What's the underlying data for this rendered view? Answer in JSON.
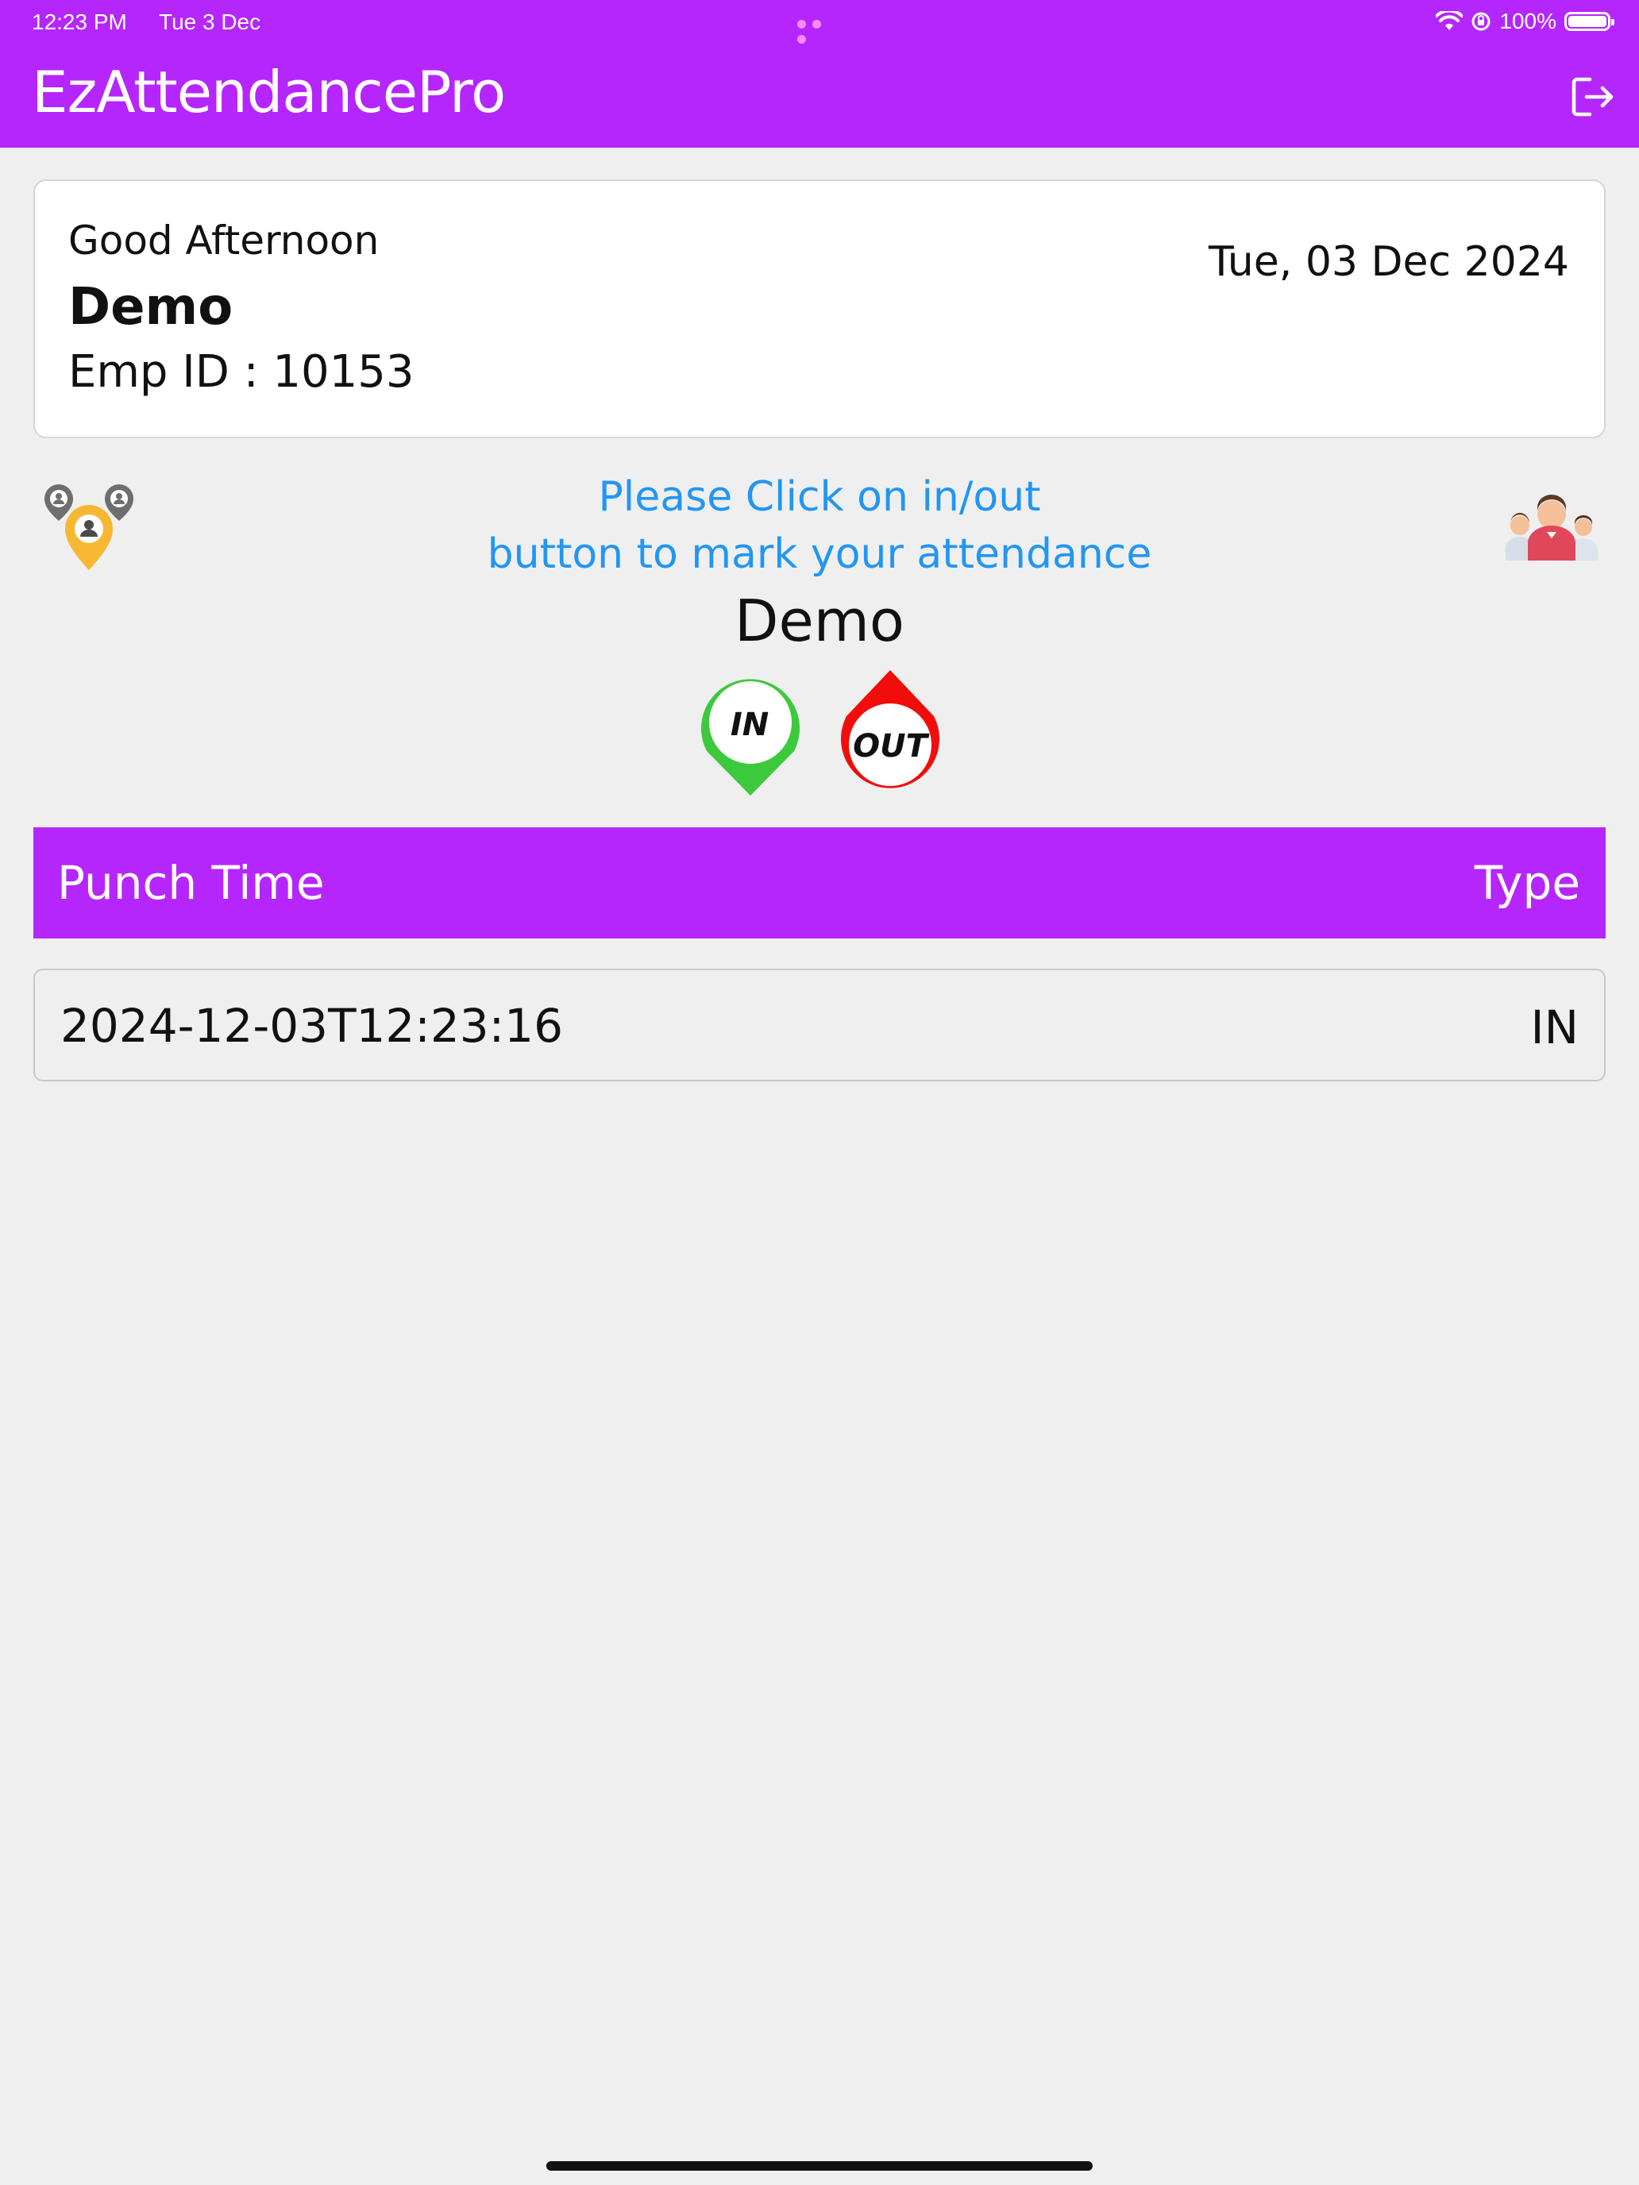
{
  "status_bar": {
    "time": "12:23 PM",
    "date": "Tue 3 Dec",
    "battery": "100%"
  },
  "header": {
    "title": "EzAttendancePro",
    "background": "#B526FC"
  },
  "greeting_card": {
    "greeting": "Good Afternoon",
    "name": "Demo",
    "emp_id": "Emp ID : 10153",
    "date": "Tue, 03 Dec 2024"
  },
  "instructions": {
    "line1": "Please Click on in/out",
    "line2": "button to mark your attendance",
    "color": "#2196F3"
  },
  "user_name": "Demo",
  "buttons": {
    "in_label": "IN",
    "in_color": "#3CC93C",
    "out_label": "OUT",
    "out_color": "#F20D0D"
  },
  "table": {
    "headers": {
      "punch_time": "Punch Time",
      "type": "Type"
    },
    "rows": [
      {
        "punch_time": "2024-12-03T12:23:16",
        "type": "IN"
      }
    ]
  },
  "icons": {
    "logout": "logout-icon",
    "location": "location-pins-icon",
    "team": "team-people-icon",
    "wifi": "wifi-icon",
    "orientation_lock": "orientation-lock-icon",
    "battery": "battery-icon"
  }
}
